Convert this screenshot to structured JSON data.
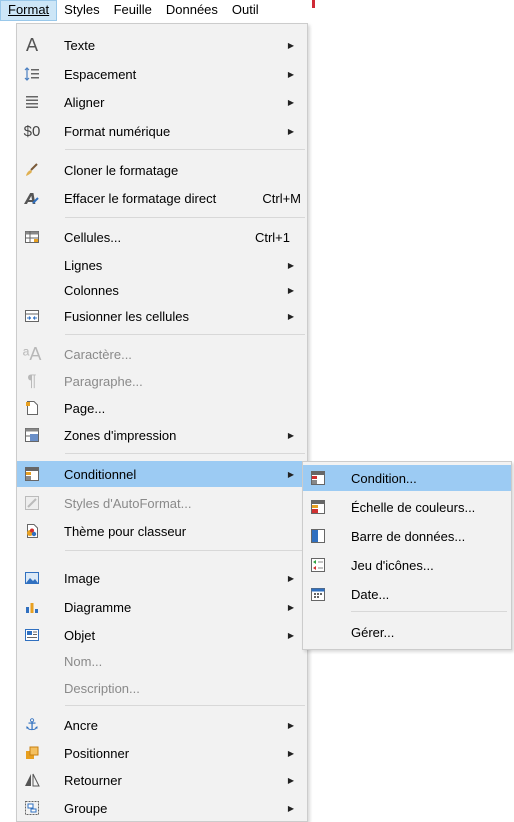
{
  "menubar": {
    "items": [
      {
        "label": "Format",
        "active": true
      },
      {
        "label": "Styles",
        "active": false
      },
      {
        "label": "Feuille",
        "active": false
      },
      {
        "label": "Données",
        "active": false
      },
      {
        "label": "Outil",
        "active": false
      }
    ]
  },
  "menu": {
    "items": [
      {
        "label": "Texte",
        "icon": "text-a-icon",
        "submenu": true
      },
      {
        "label": "Espacement",
        "icon": "spacing-icon",
        "submenu": true
      },
      {
        "label": "Aligner",
        "icon": "align-icon",
        "submenu": true
      },
      {
        "label": "Format numérique",
        "icon": "currency-format-icon",
        "submenu": true
      },
      {
        "label": "Cloner le formatage",
        "icon": "paintbrush-icon"
      },
      {
        "label": "Effacer le formatage direct",
        "icon": "clear-formatting-icon",
        "shortcut": "Ctrl+M"
      },
      {
        "label": "Cellules...",
        "icon": "cells-icon",
        "shortcut": "Ctrl+1"
      },
      {
        "label": "Lignes",
        "submenu": true
      },
      {
        "label": "Colonnes",
        "submenu": true
      },
      {
        "label": "Fusionner les cellules",
        "icon": "merge-cells-icon",
        "submenu": true
      },
      {
        "label": "Caractère...",
        "icon": "character-icon",
        "disabled": true
      },
      {
        "label": "Paragraphe...",
        "icon": "paragraph-icon",
        "disabled": true
      },
      {
        "label": "Page...",
        "icon": "page-icon"
      },
      {
        "label": "Zones d'impression",
        "icon": "print-ranges-icon",
        "submenu": true
      },
      {
        "label": "Conditionnel",
        "icon": "conditional-icon",
        "submenu": true,
        "highlighted": true
      },
      {
        "label": "Styles d'AutoFormat...",
        "icon": "autoformat-icon",
        "disabled": true
      },
      {
        "label": "Thème pour classeur",
        "icon": "theme-icon"
      },
      {
        "label": "Image",
        "icon": "image-icon",
        "submenu": true
      },
      {
        "label": "Diagramme",
        "icon": "chart-icon",
        "submenu": true
      },
      {
        "label": "Objet",
        "icon": "object-icon",
        "submenu": true
      },
      {
        "label": "Nom...",
        "disabled": true
      },
      {
        "label": "Description...",
        "disabled": true
      },
      {
        "label": "Ancre",
        "icon": "anchor-icon",
        "submenu": true
      },
      {
        "label": "Positionner",
        "icon": "position-icon",
        "submenu": true
      },
      {
        "label": "Retourner",
        "icon": "flip-icon",
        "submenu": true
      },
      {
        "label": "Groupe",
        "icon": "group-icon",
        "submenu": true
      }
    ]
  },
  "submenu": {
    "items": [
      {
        "label": "Condition...",
        "icon": "condition-icon",
        "highlighted": true
      },
      {
        "label": "Échelle de couleurs...",
        "icon": "color-scale-icon"
      },
      {
        "label": "Barre de données...",
        "icon": "data-bar-icon"
      },
      {
        "label": "Jeu d'icônes...",
        "icon": "icon-set-icon"
      },
      {
        "label": "Date...",
        "icon": "date-icon"
      },
      {
        "label": "Gérer..."
      }
    ]
  },
  "colors": {
    "highlight": "#9ccbf3",
    "menu_bg": "#f2f2f2",
    "accent_red": "#cf2a36",
    "disabled_text": "#8a8a8a"
  }
}
